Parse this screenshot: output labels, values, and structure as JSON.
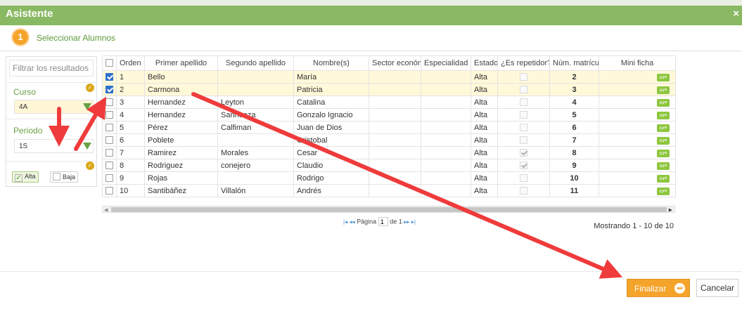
{
  "window": {
    "title": "Asistente",
    "close": "×"
  },
  "step": {
    "number": "1",
    "label": "Seleccionar Alumnos"
  },
  "filter": {
    "search_placeholder": "Filtrar los resultados",
    "curso_label": "Curso",
    "curso_value": "4A",
    "periodo_label": "Periodo",
    "periodo_value": "1S",
    "alta_label": "Alta",
    "baja_label": "Baja"
  },
  "table": {
    "columns": [
      "Orden ↓",
      "Primer apellido",
      "Segundo apellido",
      "Nombre(s)",
      "Sector económ",
      "Especialidad",
      "Estado",
      "¿Es repetidor?",
      "Núm. matrícula",
      "Mini ficha"
    ],
    "rows": [
      {
        "orden": "1",
        "primer": "Bello",
        "segundo": "",
        "nombre": "María",
        "sector": "",
        "esp": "",
        "estado": "Alta",
        "matricula": "2"
      },
      {
        "orden": "2",
        "primer": "Carmona",
        "segundo": "",
        "nombre": "Patricia",
        "sector": "",
        "esp": "",
        "estado": "Alta",
        "matricula": "3"
      },
      {
        "orden": "3",
        "primer": "Hernandez",
        "segundo": "Leyton",
        "nombre": "Catalina",
        "sector": "",
        "esp": "",
        "estado": "Alta",
        "matricula": "4"
      },
      {
        "orden": "4",
        "primer": "Hernandez",
        "segundo": "Sanhueza",
        "nombre": "Gonzalo Ignacio",
        "sector": "",
        "esp": "",
        "estado": "Alta",
        "matricula": "5"
      },
      {
        "orden": "5",
        "primer": "Pérez",
        "segundo": "Calfiman",
        "nombre": "Juan de Dios",
        "sector": "",
        "esp": "",
        "estado": "Alta",
        "matricula": "6"
      },
      {
        "orden": "6",
        "primer": "Poblete",
        "segundo": "",
        "nombre": "Cristobal",
        "sector": "",
        "esp": "",
        "estado": "Alta",
        "matricula": "7"
      },
      {
        "orden": "7",
        "primer": "Ramirez",
        "segundo": "Morales",
        "nombre": "Cesar",
        "sector": "",
        "esp": "",
        "estado": "Alta",
        "matricula": "8"
      },
      {
        "orden": "8",
        "primer": "Rodriguez",
        "segundo": "conejero",
        "nombre": "Claudio",
        "sector": "",
        "esp": "",
        "estado": "Alta",
        "matricula": "9"
      },
      {
        "orden": "9",
        "primer": "Rojas",
        "segundo": "",
        "nombre": "Rodrigo",
        "sector": "",
        "esp": "",
        "estado": "Alta",
        "matricula": "10"
      },
      {
        "orden": "10",
        "primer": "Santibáñez",
        "segundo": "Villalón",
        "nombre": "Andrés",
        "sector": "",
        "esp": "",
        "estado": "Alta",
        "matricula": "11"
      }
    ]
  },
  "pager": {
    "page_label": "Página",
    "page_value": "1",
    "of_label": "de 1"
  },
  "status": "Mostrando 1 - 10 de 10",
  "buttons": {
    "finalizar": "Finalizar",
    "cancelar": "Cancelar"
  },
  "colors": {
    "header_green": "#89b962",
    "accent_orange": "#f4a42a",
    "annotation_red": "#ef3b3b"
  }
}
